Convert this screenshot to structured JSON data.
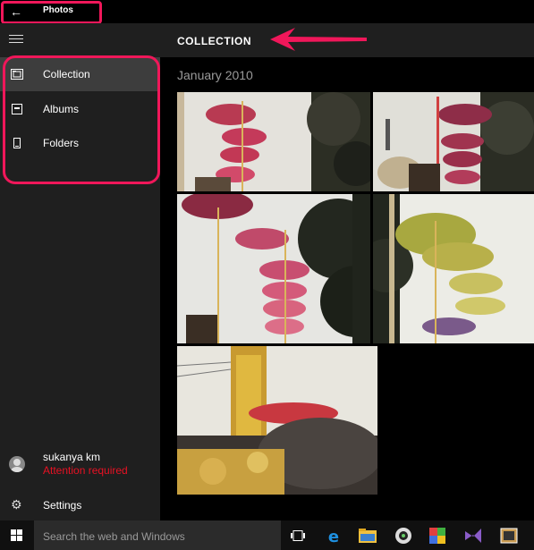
{
  "window": {
    "title": "Photos",
    "back_icon": "back-arrow-icon"
  },
  "sidebar": {
    "items": [
      {
        "label": "Collection",
        "icon": "collection-icon",
        "active": true
      },
      {
        "label": "Albums",
        "icon": "album-icon",
        "active": false
      },
      {
        "label": "Folders",
        "icon": "folder-icon",
        "active": false
      }
    ],
    "user": {
      "name": "sukanya km",
      "status": "Attention required",
      "status_color": "#e81123"
    },
    "settings_label": "Settings"
  },
  "main": {
    "title": "COLLECTION",
    "section": "January 2010",
    "photos": [
      {
        "subject": "festival-umbrellas"
      },
      {
        "subject": "festival-umbrellas"
      },
      {
        "subject": "festival-umbrellas"
      },
      {
        "subject": "festival-umbrellas"
      },
      {
        "subject": "elephant-caparison"
      }
    ]
  },
  "taskbar": {
    "search_placeholder": "Search the web and Windows",
    "icons": [
      "task-view-icon",
      "edge-icon",
      "file-explorer-icon",
      "media-icon",
      "paint-icon",
      "visual-studio-icon",
      "app-icon"
    ]
  },
  "colors": {
    "annotation": "#f0175a",
    "sidebar_bg": "#1f1f1f",
    "active_bg": "#3d3d3d"
  }
}
